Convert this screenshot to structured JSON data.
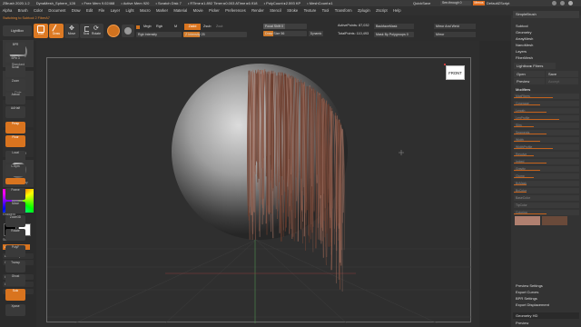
{
  "titlebar": {
    "items": [
      "ZBrush 2020.1.2",
      "DynaMesh_Sphere_128",
      "• Free Mem 9.02468",
      "• Active Mem 920",
      "• Scratch Disk 7",
      "• RTime ▸1.892 Timer ▸0.003 ATime ▸6.918",
      "• PolyCount ▸2.593 KP",
      "• MeshCount ▸1"
    ],
    "quicksave": "QuickSave",
    "seethrough": "See-through  0",
    "menus_label": "Menus",
    "script": "DefaultZScript"
  },
  "menubar": {
    "items": [
      "Alpha",
      "Brush",
      "Color",
      "Document",
      "Draw",
      "Edit",
      "File",
      "Layer",
      "Light",
      "Macro",
      "Marker",
      "Material",
      "Movie",
      "Picker",
      "Preferences",
      "Render",
      "Stencil",
      "Stroke",
      "Texture",
      "Tool",
      "Transform",
      "Zplugin",
      "Zscript",
      "Help"
    ]
  },
  "status_message": "Switching to Subtool 2  FiberA7",
  "topshelf": {
    "lightbox": "LightBox",
    "buttons": [
      "Edit",
      "Draw",
      "Move",
      "Scale",
      "Rotate"
    ],
    "mrgb": "Mrgb",
    "rgb": "Rgb",
    "m": "M",
    "zadd": "Zadd",
    "zsub": "Zsub",
    "zcut": "Zcut",
    "rgb_intensity": "Rgb Intensity",
    "z_intensity": "Z Intensity 25",
    "focal_shift": "Focal Shift 0",
    "draw_size": "Draw Size 56",
    "dynamic": "Dynamic",
    "active_points": "ActivePoints: 87,032",
    "total_points": "TotalPoints: 110,493",
    "backface_mask": "BackfaceMask",
    "mask_by_polygroups": "Mask By Polygroups 0",
    "mirror_and_weld": "Mirror And Weld",
    "mirror": "Mirror"
  },
  "left": {
    "lightbox": "LightBox",
    "brush": "Standard",
    "stroke": "Dots",
    "alpha": "Alpha Off",
    "texture": "Texture Off",
    "material": "MatCap Gray",
    "gradient": "Gradient",
    "switch_color": "SwitchColor",
    "alternate": "Alternate",
    "items": [
      "Auto Groups",
      "Groups Split",
      "Groups Split",
      "Close Holes",
      "Transfer All"
    ]
  },
  "viewport": {
    "navcube": "FRONT"
  },
  "right": {
    "buttons": [
      "BPR",
      "SPix 3",
      "Scroll",
      "Zoom",
      "Actual",
      "AAHalf",
      "Persp",
      "Floor",
      "Local",
      "L.Sym",
      "Frame",
      "Move",
      "Zoom3D",
      "Rotate",
      "PolyF",
      "Transp",
      "Ghost",
      "Solo",
      "Xpose"
    ]
  },
  "panel": {
    "header": "SimpleBrush",
    "items": [
      "Subtool",
      "Geometry",
      "ArrayMesh",
      "NanoMesh",
      "Layers",
      "FiberMesh"
    ],
    "lightbox_fibers": "Lightbox▸ Fibers",
    "open": "Open",
    "save": "Save",
    "preview": "Preview",
    "accept": "Accept",
    "modifiers": "Modifiers",
    "mod_rows": [
      "MaxFibers",
      "Coverage",
      "Length",
      "LenProfile",
      "Slim",
      "Segments",
      "Width",
      "WidthProfile",
      "Revolve",
      "Imbed",
      "Gravity",
      "Clump",
      "ByMask",
      "ByColor",
      "BaseColor",
      "TipColor",
      "Coloring"
    ],
    "bottom": [
      "Preview Settings",
      "Export Curves",
      "BPR Settings",
      "Export Displacement",
      "Geometry HD",
      "Preview"
    ]
  },
  "colors": {
    "accent": "#e06d1e",
    "base_color": "#b08070",
    "tip_color": "#6a4a3a"
  }
}
